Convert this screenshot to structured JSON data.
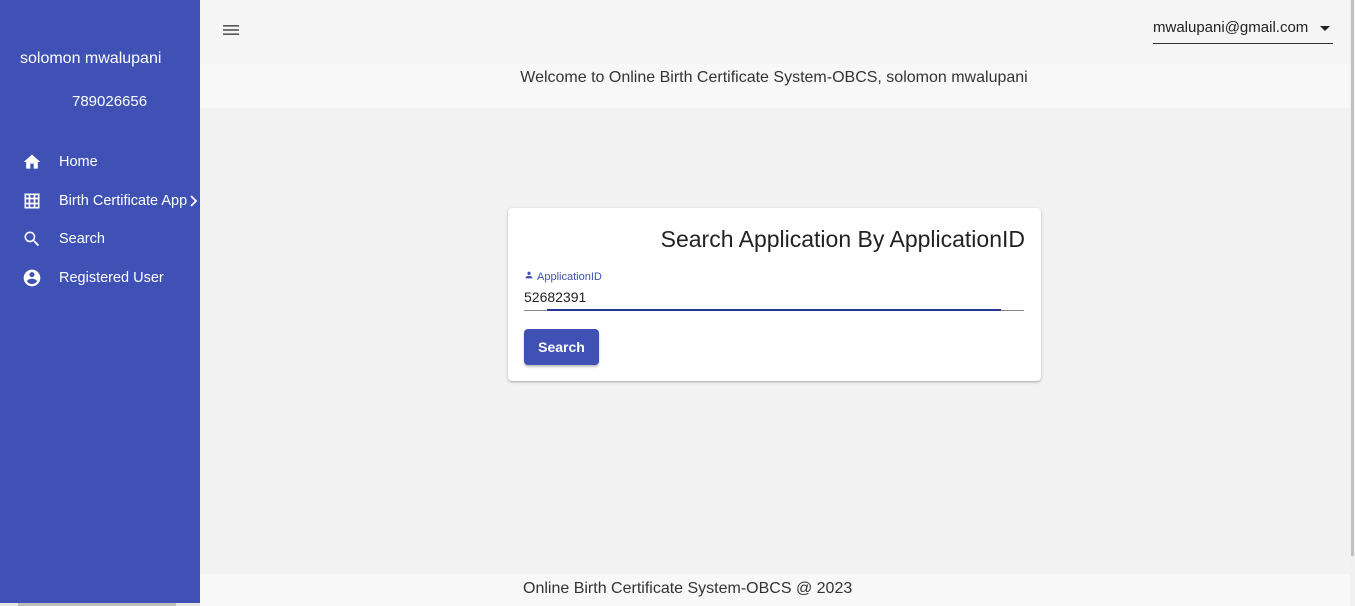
{
  "sidebar": {
    "user_name": "solomon mwalupani",
    "user_phone": "789026656",
    "items": [
      {
        "label": "Home",
        "icon": "home-icon"
      },
      {
        "label": "Birth Certificate App",
        "icon": "grid-icon",
        "has_submenu": true
      },
      {
        "label": "Search",
        "icon": "search-icon"
      },
      {
        "label": "Registered User",
        "icon": "account-circle-icon"
      }
    ]
  },
  "topbar": {
    "menu_icon": "menu-icon",
    "account_email": "mwalupani@gmail.com"
  },
  "welcome": {
    "text": "Welcome to Online Birth Certificate System-OBCS, solomon mwalupani"
  },
  "search_card": {
    "title": "Search Application By ApplicationID",
    "field_label": "ApplicationID",
    "field_value": "52682391",
    "button_label": "Search"
  },
  "footer": {
    "text": "Online Birth Certificate System-OBCS @ 2023"
  },
  "colors": {
    "primary": "#3f51b5",
    "focus_underline": "#283593",
    "background": "#f2f2f2"
  }
}
